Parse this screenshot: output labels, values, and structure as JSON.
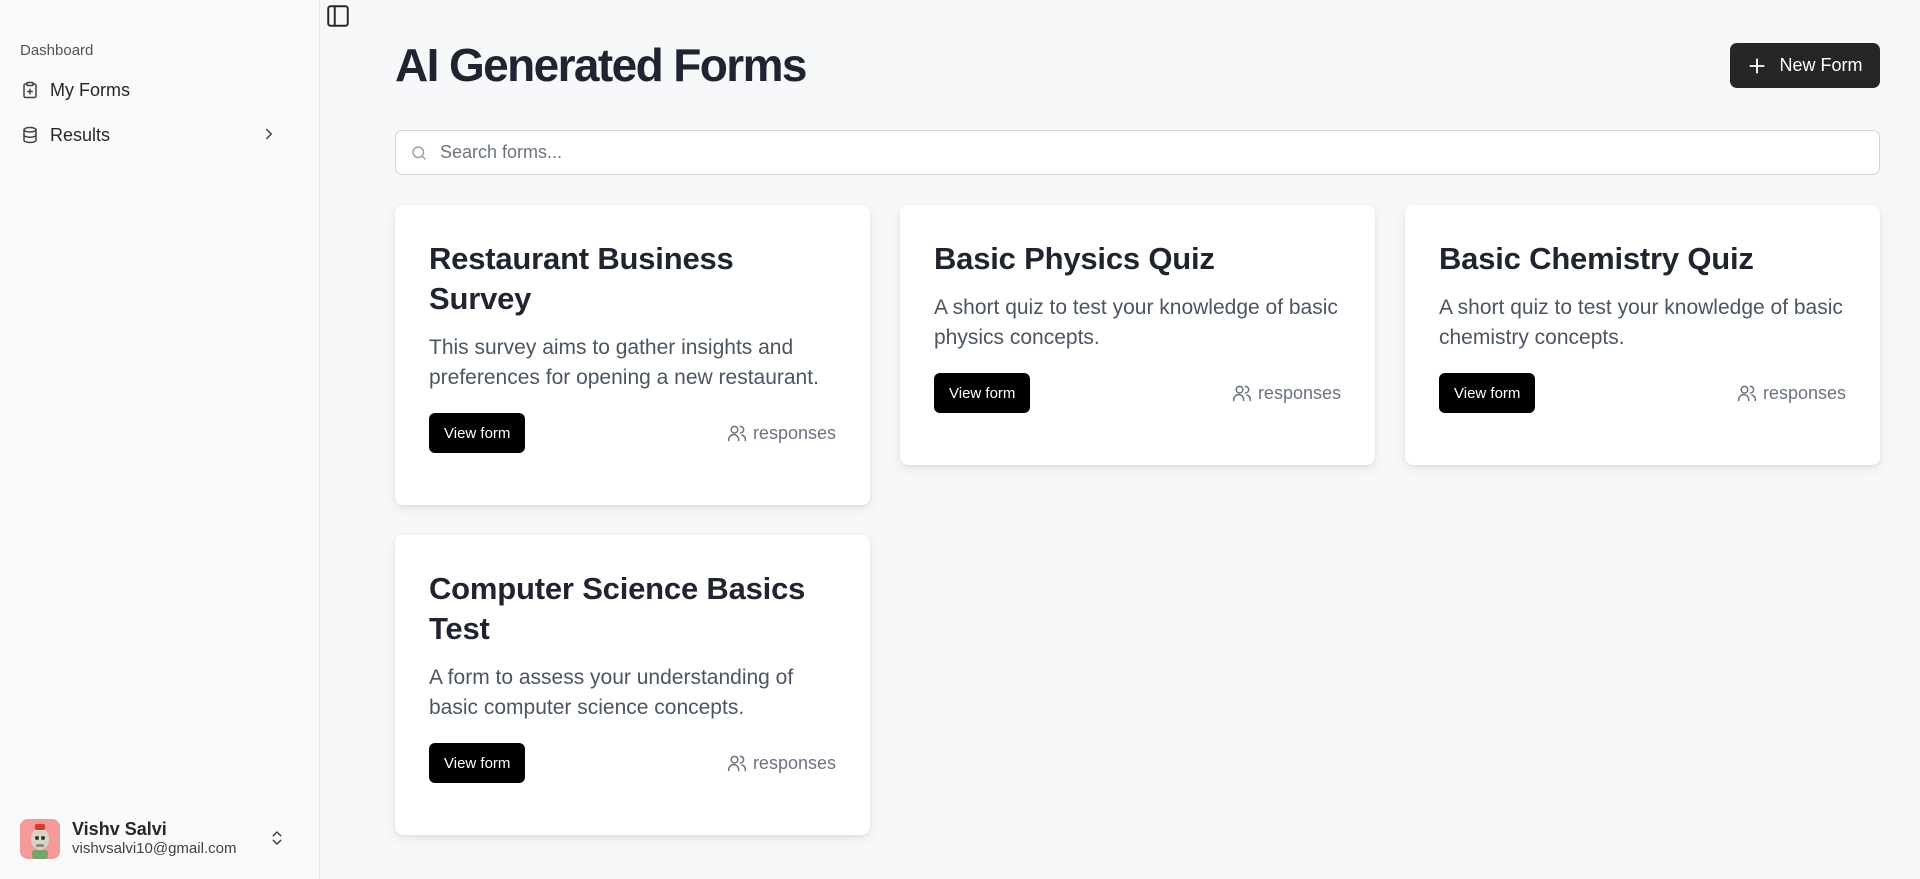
{
  "sidebar": {
    "group_label": "Dashboard",
    "items": [
      {
        "label": "My Forms",
        "icon": "clipboard-icon"
      },
      {
        "label": "Results",
        "icon": "database-icon"
      }
    ],
    "user": {
      "name": "Vishv Salvi",
      "email": "vishvsalvi10@gmail.com"
    }
  },
  "header": {
    "title": "AI Generated Forms",
    "new_form_label": "New Form"
  },
  "search": {
    "placeholder": "Search forms...",
    "value": ""
  },
  "forms": [
    {
      "title": "Restaurant Business Survey",
      "description": "This survey aims to gather insights and preferences for opening a new restaurant.",
      "button_label": "View form",
      "responses_label": "responses"
    },
    {
      "title": "Basic Physics Quiz",
      "description": "A short quiz to test your knowledge of basic physics concepts.",
      "button_label": "View form",
      "responses_label": "responses"
    },
    {
      "title": "Basic Chemistry Quiz",
      "description": "A short quiz to test your knowledge of basic chemistry concepts.",
      "button_label": "View form",
      "responses_label": "responses"
    },
    {
      "title": "Computer Science Basics Test",
      "description": "A form to assess your understanding of basic computer science concepts.",
      "button_label": "View form",
      "responses_label": "responses"
    }
  ],
  "colors": {
    "primary_button": "#000000",
    "new_form_button": "#262626",
    "avatar_bg": "#f59a9a"
  }
}
